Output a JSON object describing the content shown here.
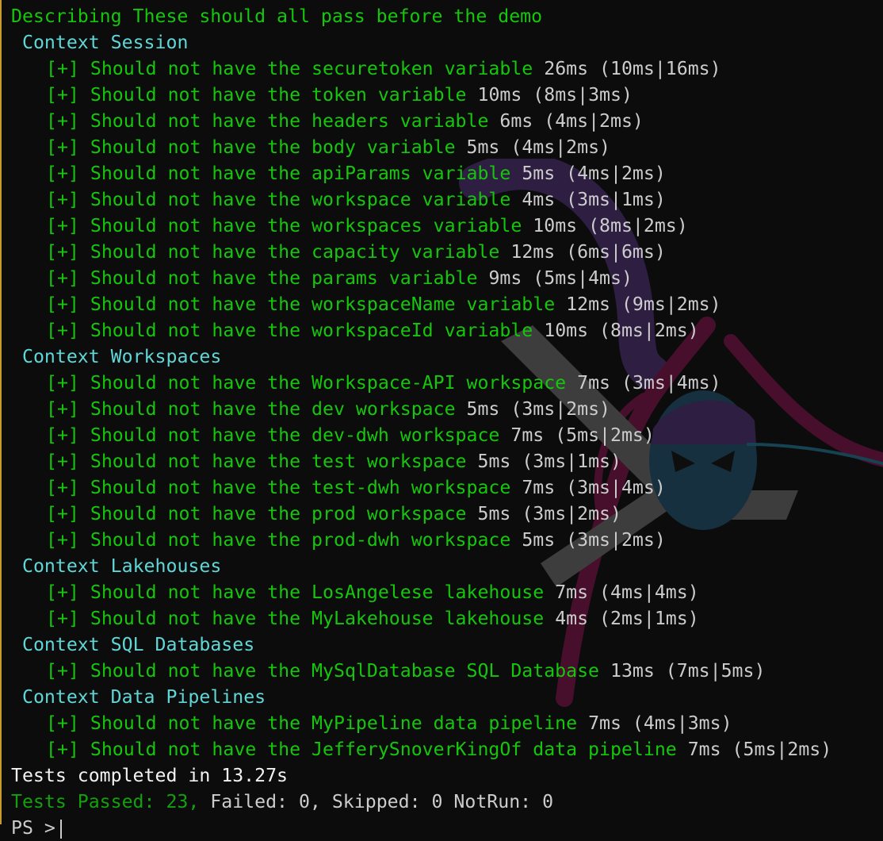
{
  "describe": "Describing These should all pass before the demo",
  "contexts": [
    {
      "title": "Context Session",
      "tests": [
        {
          "mark": "[+]",
          "name": "Should not have the securetoken variable",
          "time": "26ms (10ms|16ms)"
        },
        {
          "mark": "[+]",
          "name": "Should not have the token variable",
          "time": "10ms (8ms|3ms)"
        },
        {
          "mark": "[+]",
          "name": "Should not have the headers variable",
          "time": "6ms (4ms|2ms)"
        },
        {
          "mark": "[+]",
          "name": "Should not have the body variable",
          "time": "5ms (4ms|2ms)"
        },
        {
          "mark": "[+]",
          "name": "Should not have the apiParams variable",
          "time": "5ms (4ms|2ms)"
        },
        {
          "mark": "[+]",
          "name": "Should not have the workspace variable",
          "time": "4ms (3ms|1ms)"
        },
        {
          "mark": "[+]",
          "name": "Should not have the workspaces variable",
          "time": "10ms (8ms|2ms)"
        },
        {
          "mark": "[+]",
          "name": "Should not have the capacity variable",
          "time": "12ms (6ms|6ms)"
        },
        {
          "mark": "[+]",
          "name": "Should not have the params variable",
          "time": "9ms (5ms|4ms)"
        },
        {
          "mark": "[+]",
          "name": "Should not have the workspaceName variable",
          "time": "12ms (9ms|2ms)"
        },
        {
          "mark": "[+]",
          "name": "Should not have the workspaceId variable",
          "time": "10ms (8ms|2ms)"
        }
      ]
    },
    {
      "title": "Context Workspaces",
      "tests": [
        {
          "mark": "[+]",
          "name": "Should not have the Workspace-API workspace",
          "time": "7ms (3ms|4ms)"
        },
        {
          "mark": "[+]",
          "name": "Should not have the dev workspace",
          "time": "5ms (3ms|2ms)"
        },
        {
          "mark": "[+]",
          "name": "Should not have the dev-dwh workspace",
          "time": "7ms (5ms|2ms)"
        },
        {
          "mark": "[+]",
          "name": "Should not have the test workspace",
          "time": "5ms (3ms|1ms)"
        },
        {
          "mark": "[+]",
          "name": "Should not have the test-dwh workspace",
          "time": "7ms (3ms|4ms)"
        },
        {
          "mark": "[+]",
          "name": "Should not have the prod workspace",
          "time": "5ms (3ms|2ms)"
        },
        {
          "mark": "[+]",
          "name": "Should not have the prod-dwh workspace",
          "time": "5ms (3ms|2ms)"
        }
      ]
    },
    {
      "title": "Context Lakehouses",
      "tests": [
        {
          "mark": "[+]",
          "name": "Should not have the LosAngelese lakehouse",
          "time": "7ms (4ms|4ms)"
        },
        {
          "mark": "[+]",
          "name": "Should not have the MyLakehouse lakehouse",
          "time": "4ms (2ms|1ms)"
        }
      ]
    },
    {
      "title": "Context SQL Databases",
      "tests": [
        {
          "mark": "[+]",
          "name": "Should not have the MySqlDatabase SQL Database",
          "time": "13ms (7ms|5ms)"
        }
      ]
    },
    {
      "title": "Context Data Pipelines",
      "tests": [
        {
          "mark": "[+]",
          "name": "Should not have the MyPipeline data pipeline",
          "time": "7ms (4ms|3ms)"
        },
        {
          "mark": "[+]",
          "name": "Should not have the JefferySnoverKingOf data pipeline",
          "time": "7ms (5ms|2ms)"
        }
      ]
    }
  ],
  "summary": "Tests completed in 13.27s",
  "results": {
    "passed": "Tests Passed: 23,",
    "rest": " Failed: 0, Skipped: 0 NotRun: 0"
  },
  "prompt": "PS >",
  "colors": {
    "background": "#0c0c0c",
    "pass_green": "#16c60c",
    "context_cyan": "#61d6d6",
    "timing_gray": "#cccccc",
    "border_accent": "#c79a2a"
  },
  "watermark_icon": "pester-ninja-logo-icon"
}
